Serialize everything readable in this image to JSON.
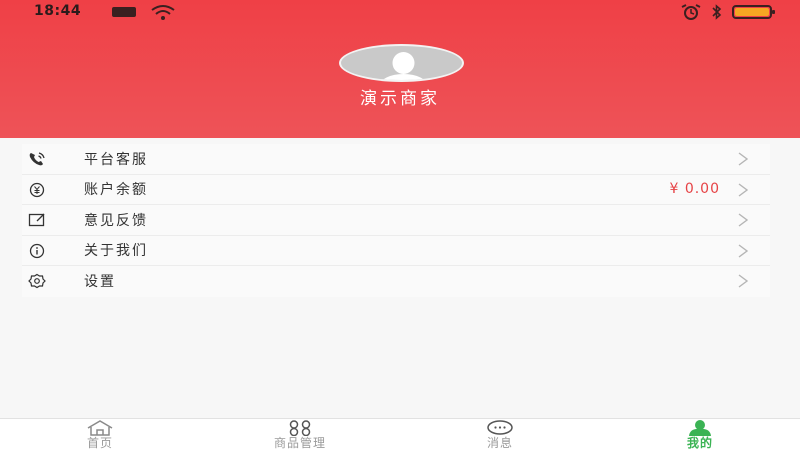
{
  "status_bar": {
    "time": "18:44"
  },
  "header": {
    "merchant_name": "演示商家"
  },
  "menu": {
    "items": [
      {
        "label": "平台客服",
        "icon": "phone-icon",
        "value": ""
      },
      {
        "label": "账户余额",
        "icon": "yuan-coin-icon",
        "value": "¥ 0.00"
      },
      {
        "label": "意见反馈",
        "icon": "feedback-edit-icon",
        "value": ""
      },
      {
        "label": "关于我们",
        "icon": "info-icon",
        "value": ""
      },
      {
        "label": "设置",
        "icon": "gear-icon",
        "value": ""
      }
    ]
  },
  "tabbar": {
    "tabs": [
      {
        "label": "首页",
        "icon": "home-icon",
        "active": false
      },
      {
        "label": "商品管理",
        "icon": "grid-icon",
        "active": false
      },
      {
        "label": "消息",
        "icon": "chat-bubble-icon",
        "active": false
      },
      {
        "label": "我的",
        "icon": "user-icon",
        "active": true
      }
    ]
  },
  "colors": {
    "header": "#ef4046",
    "accent_price": "#e64346",
    "tab_active": "#3bb354",
    "tab_inactive": "#9a9a9a"
  }
}
